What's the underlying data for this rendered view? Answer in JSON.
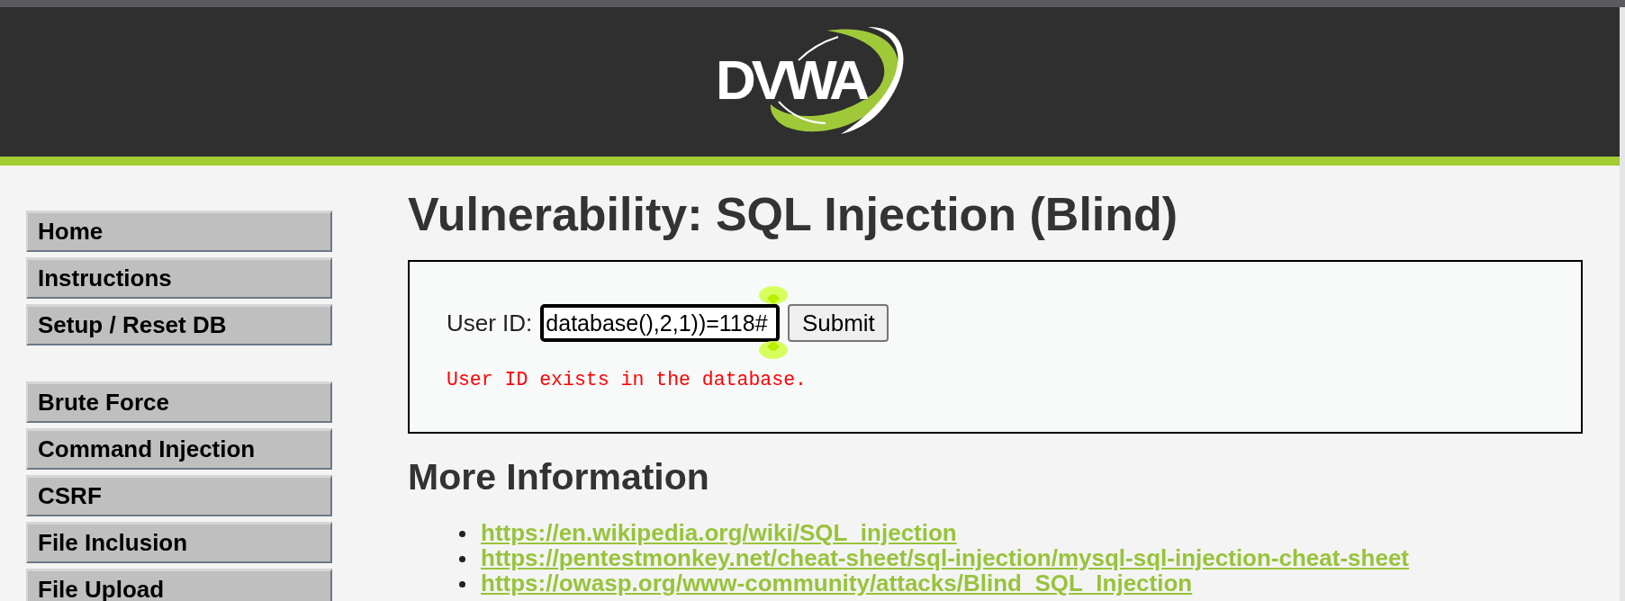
{
  "header": {
    "logo_text": "DVWA"
  },
  "sidebar": {
    "groups": [
      {
        "items": [
          {
            "label": "Home",
            "selected": false
          },
          {
            "label": "Instructions",
            "selected": false
          },
          {
            "label": "Setup / Reset DB",
            "selected": false
          }
        ]
      },
      {
        "items": [
          {
            "label": "Brute Force",
            "selected": false
          },
          {
            "label": "Command Injection",
            "selected": false
          },
          {
            "label": "CSRF",
            "selected": false
          },
          {
            "label": "File Inclusion",
            "selected": false
          },
          {
            "label": "File Upload",
            "selected": false
          }
        ]
      }
    ]
  },
  "main": {
    "title": "Vulnerability: SQL Injection (Blind)",
    "form": {
      "label": "User ID:",
      "input": {
        "value": "database(),2,1))=118#",
        "focused": true
      },
      "submit": "Submit",
      "message": "User ID exists in the database."
    }
  },
  "more_info": {
    "heading": "More Information",
    "links": [
      "https://en.wikipedia.org/wiki/SQL_injection",
      "https://pentestmonkey.net/cheat-sheet/sql-injection/mysql-sql-injection-cheat-sheet",
      "https://owasp.org/www-community/attacks/Blind_SQL_Injection"
    ]
  }
}
